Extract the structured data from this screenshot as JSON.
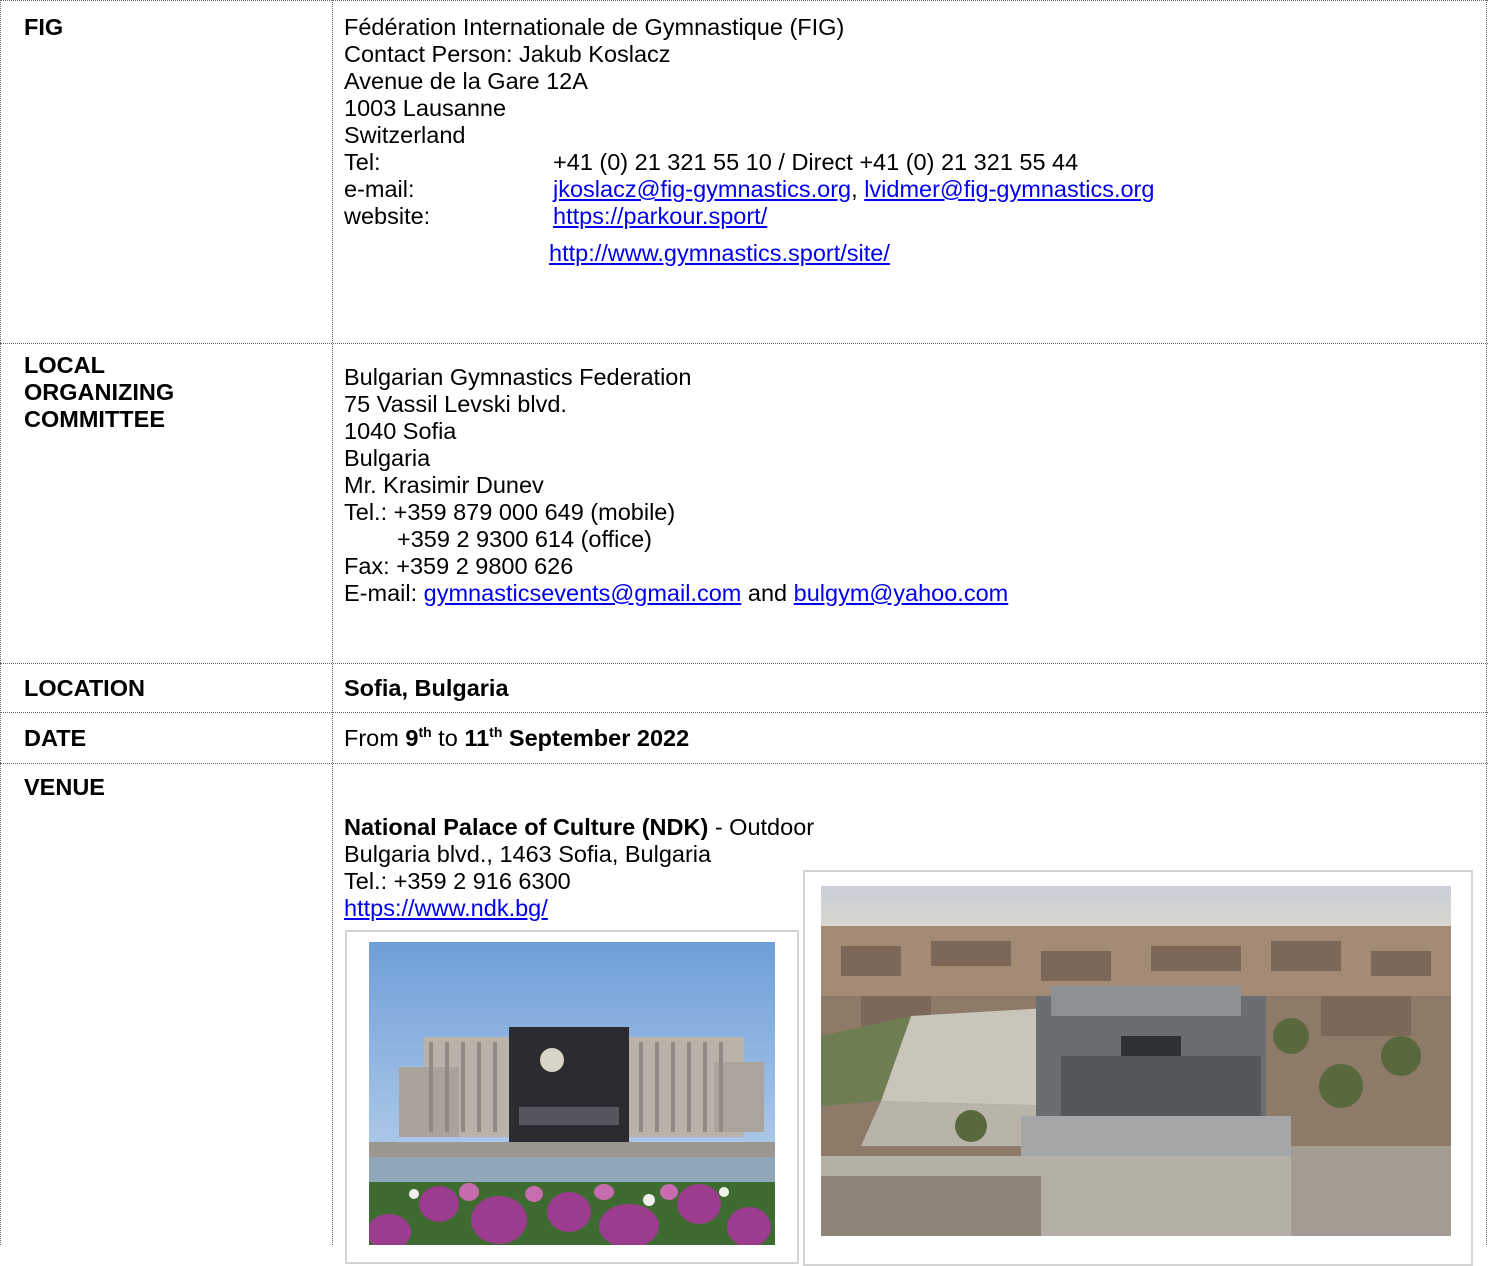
{
  "fig": {
    "label": "FIG",
    "org": "Fédération Internationale de Gymnastique (FIG)",
    "contact": "Contact Person: Jakub Koslacz",
    "street": "Avenue de la Gare 12A",
    "city": "1003 Lausanne",
    "country": "Switzerland",
    "tel_label": "Tel:",
    "tel_value": "+41 (0) 21 321 55 10 / Direct +41 (0) 21 321 55 44",
    "email_label": "e-mail:",
    "email_1": "jkoslacz@fig-gymnastics.org",
    "email_sep": ", ",
    "email_2": "lvidmer@fig-gymnastics.org",
    "website_label": "website:",
    "website_1": "https://parkour.sport/",
    "website_2": "http://www.gymnastics.sport/site/"
  },
  "loc": {
    "label_1": "LOCAL",
    "label_2": "ORGANIZING",
    "label_3": "COMMITTEE",
    "org": "Bulgarian Gymnastics Federation",
    "street": "75 Vassil Levski blvd.",
    "city": "1040 Sofia",
    "country": "Bulgaria",
    "person": "Mr. Krasimir Dunev",
    "tel_1": "Tel.: +359 879 000 649 (mobile)",
    "tel_2": "+359 2 9300 614 (office)",
    "fax": "Fax: +359 2 9800 626",
    "email_prefix": "E-mail: ",
    "email_1": "gymnasticsevents@gmail.com",
    "email_and": " and ",
    "email_2": "bulgym@yahoo.com"
  },
  "location": {
    "label": "LOCATION",
    "value": "Sofia, Bulgaria"
  },
  "date": {
    "label": "DATE",
    "from": "From ",
    "d1": "9",
    "d1_sup": "th",
    "to": " to ",
    "d2": "11",
    "d2_sup": "th",
    "rest": " September 2022"
  },
  "venue": {
    "label": "VENUE",
    "name": "National Palace of Culture (NDK)",
    "name_suffix": " - Outdoor",
    "address": "Bulgaria blvd., 1463 Sofia, Bulgaria",
    "tel": "Tel.: +359 2 916 6300",
    "website": "https://www.ndk.bg/"
  },
  "colors": {
    "link": "#0000ee",
    "rule": "#6b6b6b",
    "frame": "#d4d4d4"
  }
}
